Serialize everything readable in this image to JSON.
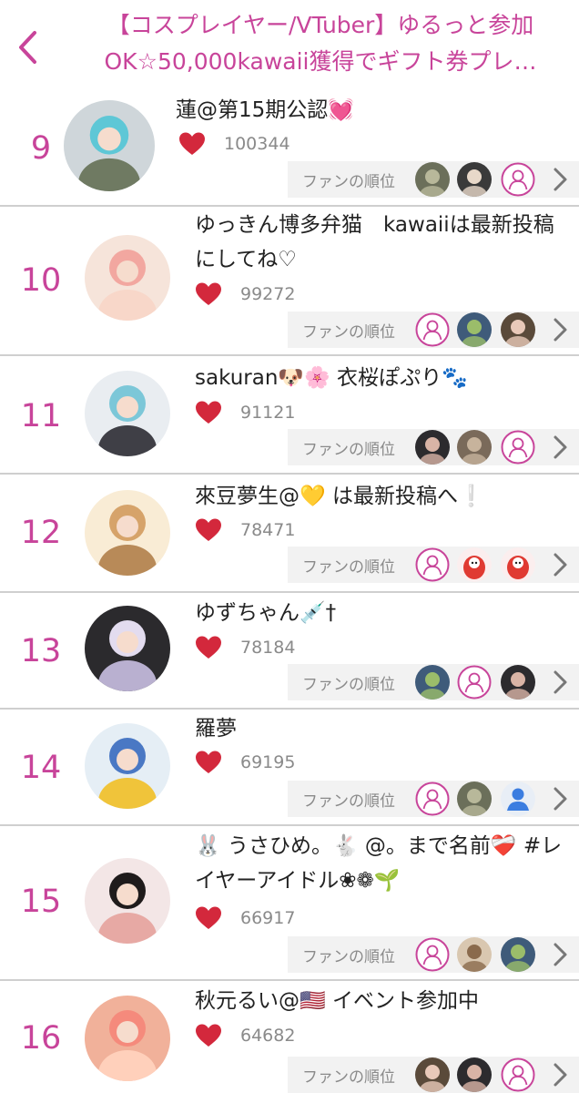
{
  "header": {
    "title_line1": "【コスプレイヤー/VTuber】ゆるっと参加",
    "title_line2": "OK☆50,000kawaii獲得でギフト券プレ…"
  },
  "colors": {
    "accent": "#c8449a",
    "heart": "#d3283c",
    "muted": "#8a8a8a",
    "fan_bar": "#f2f2f2"
  },
  "fan_label": "ファンの順位",
  "rows": [
    {
      "rank": "9",
      "name": "蓮@第15期公認💓",
      "likes": "100344",
      "fans": [
        "photo-fan-icon",
        "photo-fan-icon",
        "default-user-icon"
      ]
    },
    {
      "rank": "10",
      "name": "ゆっきん博多弁猫　kawaiiは最新投稿にしてね♡",
      "likes": "99272",
      "fans": [
        "default-user-icon",
        "photo-fan-icon",
        "photo-fan-icon"
      ]
    },
    {
      "rank": "11",
      "name": "sakuran🐶🌸 衣桜ぽぷり🐾",
      "likes": "91121",
      "fans": [
        "photo-fan-icon",
        "photo-fan-icon",
        "default-user-icon"
      ]
    },
    {
      "rank": "12",
      "name": "來豆夢生@💛 は最新投稿へ❕",
      "likes": "78471",
      "fans": [
        "default-user-icon",
        "daruma-icon",
        "daruma-icon"
      ]
    },
    {
      "rank": "13",
      "name": "ゆずちゃん💉†",
      "likes": "78184",
      "fans": [
        "photo-fan-icon",
        "default-user-icon",
        "photo-fan-icon"
      ]
    },
    {
      "rank": "14",
      "name": "羅夢",
      "likes": "69195",
      "fans": [
        "default-user-icon",
        "photo-fan-icon",
        "blue-user-icon"
      ]
    },
    {
      "rank": "15",
      "name": "🐰 うさひめ。🐇 @。まで名前❤️‍🩹 #レイヤーアイドル❀❁🌱",
      "likes": "66917",
      "fans": [
        "default-user-icon",
        "photo-fan-icon",
        "photo-fan-icon"
      ]
    },
    {
      "rank": "16",
      "name": "秋元るい@🇺🇸 イベント参加中",
      "likes": "64682",
      "fans": [
        "photo-fan-icon",
        "photo-fan-icon",
        "default-user-icon"
      ]
    }
  ]
}
